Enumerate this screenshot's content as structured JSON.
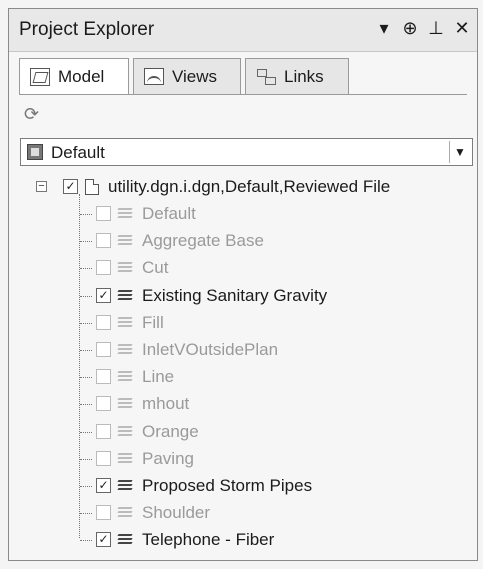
{
  "panel": {
    "title": "Project Explorer",
    "controls": {
      "dropdown": "▾",
      "pin1": "⊕",
      "pin2": "⊥",
      "close": "✕"
    }
  },
  "tabs": [
    {
      "label": "Model",
      "icon": "model-icon",
      "active": true
    },
    {
      "label": "Views",
      "icon": "views-icon",
      "active": false
    },
    {
      "label": "Links",
      "icon": "links-icon",
      "active": false
    }
  ],
  "refresh_icon": "⟳",
  "model_dropdown": {
    "value": "Default",
    "arrow": "▼"
  },
  "tree": {
    "root": {
      "label": "utility.dgn.i.dgn,Default,Reviewed File",
      "checked": true,
      "expanded": true,
      "expander": "−",
      "check": "✓"
    },
    "levels": [
      {
        "label": "Default",
        "checked": false
      },
      {
        "label": "Aggregate Base",
        "checked": false
      },
      {
        "label": "Cut",
        "checked": false
      },
      {
        "label": "Existing Sanitary Gravity",
        "checked": true
      },
      {
        "label": "Fill",
        "checked": false
      },
      {
        "label": "InletVOutsidePlan",
        "checked": false
      },
      {
        "label": "Line",
        "checked": false
      },
      {
        "label": "mhout",
        "checked": false
      },
      {
        "label": "Orange",
        "checked": false
      },
      {
        "label": "Paving",
        "checked": false
      },
      {
        "label": "Proposed Storm Pipes",
        "checked": true
      },
      {
        "label": "Shoulder",
        "checked": false
      },
      {
        "label": "Telephone - Fiber",
        "checked": true
      }
    ],
    "check_glyph": "✓"
  },
  "colors": {
    "active_text": "#1b1b1b",
    "disabled_text": "#9a9a9a",
    "panel_bg": "#f6f6f6"
  }
}
